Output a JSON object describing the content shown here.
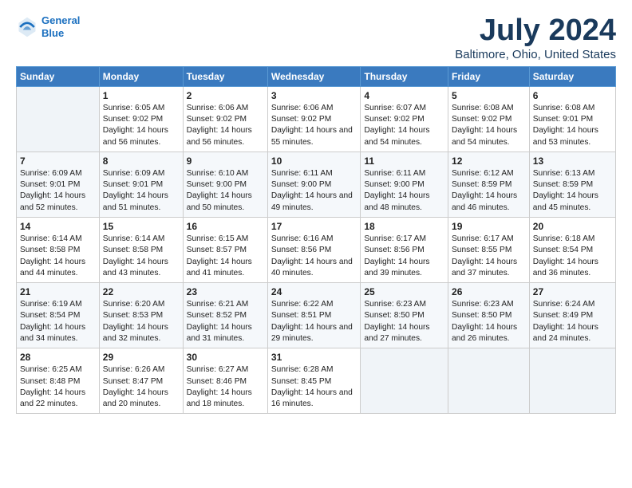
{
  "header": {
    "logo_line1": "General",
    "logo_line2": "Blue",
    "title": "July 2024",
    "subtitle": "Baltimore, Ohio, United States"
  },
  "columns": [
    "Sunday",
    "Monday",
    "Tuesday",
    "Wednesday",
    "Thursday",
    "Friday",
    "Saturday"
  ],
  "weeks": [
    [
      {
        "day": "",
        "sunrise": "",
        "sunset": "",
        "daylight": ""
      },
      {
        "day": "1",
        "sunrise": "Sunrise: 6:05 AM",
        "sunset": "Sunset: 9:02 PM",
        "daylight": "Daylight: 14 hours and 56 minutes."
      },
      {
        "day": "2",
        "sunrise": "Sunrise: 6:06 AM",
        "sunset": "Sunset: 9:02 PM",
        "daylight": "Daylight: 14 hours and 56 minutes."
      },
      {
        "day": "3",
        "sunrise": "Sunrise: 6:06 AM",
        "sunset": "Sunset: 9:02 PM",
        "daylight": "Daylight: 14 hours and 55 minutes."
      },
      {
        "day": "4",
        "sunrise": "Sunrise: 6:07 AM",
        "sunset": "Sunset: 9:02 PM",
        "daylight": "Daylight: 14 hours and 54 minutes."
      },
      {
        "day": "5",
        "sunrise": "Sunrise: 6:08 AM",
        "sunset": "Sunset: 9:02 PM",
        "daylight": "Daylight: 14 hours and 54 minutes."
      },
      {
        "day": "6",
        "sunrise": "Sunrise: 6:08 AM",
        "sunset": "Sunset: 9:01 PM",
        "daylight": "Daylight: 14 hours and 53 minutes."
      }
    ],
    [
      {
        "day": "7",
        "sunrise": "Sunrise: 6:09 AM",
        "sunset": "Sunset: 9:01 PM",
        "daylight": "Daylight: 14 hours and 52 minutes."
      },
      {
        "day": "8",
        "sunrise": "Sunrise: 6:09 AM",
        "sunset": "Sunset: 9:01 PM",
        "daylight": "Daylight: 14 hours and 51 minutes."
      },
      {
        "day": "9",
        "sunrise": "Sunrise: 6:10 AM",
        "sunset": "Sunset: 9:00 PM",
        "daylight": "Daylight: 14 hours and 50 minutes."
      },
      {
        "day": "10",
        "sunrise": "Sunrise: 6:11 AM",
        "sunset": "Sunset: 9:00 PM",
        "daylight": "Daylight: 14 hours and 49 minutes."
      },
      {
        "day": "11",
        "sunrise": "Sunrise: 6:11 AM",
        "sunset": "Sunset: 9:00 PM",
        "daylight": "Daylight: 14 hours and 48 minutes."
      },
      {
        "day": "12",
        "sunrise": "Sunrise: 6:12 AM",
        "sunset": "Sunset: 8:59 PM",
        "daylight": "Daylight: 14 hours and 46 minutes."
      },
      {
        "day": "13",
        "sunrise": "Sunrise: 6:13 AM",
        "sunset": "Sunset: 8:59 PM",
        "daylight": "Daylight: 14 hours and 45 minutes."
      }
    ],
    [
      {
        "day": "14",
        "sunrise": "Sunrise: 6:14 AM",
        "sunset": "Sunset: 8:58 PM",
        "daylight": "Daylight: 14 hours and 44 minutes."
      },
      {
        "day": "15",
        "sunrise": "Sunrise: 6:14 AM",
        "sunset": "Sunset: 8:58 PM",
        "daylight": "Daylight: 14 hours and 43 minutes."
      },
      {
        "day": "16",
        "sunrise": "Sunrise: 6:15 AM",
        "sunset": "Sunset: 8:57 PM",
        "daylight": "Daylight: 14 hours and 41 minutes."
      },
      {
        "day": "17",
        "sunrise": "Sunrise: 6:16 AM",
        "sunset": "Sunset: 8:56 PM",
        "daylight": "Daylight: 14 hours and 40 minutes."
      },
      {
        "day": "18",
        "sunrise": "Sunrise: 6:17 AM",
        "sunset": "Sunset: 8:56 PM",
        "daylight": "Daylight: 14 hours and 39 minutes."
      },
      {
        "day": "19",
        "sunrise": "Sunrise: 6:17 AM",
        "sunset": "Sunset: 8:55 PM",
        "daylight": "Daylight: 14 hours and 37 minutes."
      },
      {
        "day": "20",
        "sunrise": "Sunrise: 6:18 AM",
        "sunset": "Sunset: 8:54 PM",
        "daylight": "Daylight: 14 hours and 36 minutes."
      }
    ],
    [
      {
        "day": "21",
        "sunrise": "Sunrise: 6:19 AM",
        "sunset": "Sunset: 8:54 PM",
        "daylight": "Daylight: 14 hours and 34 minutes."
      },
      {
        "day": "22",
        "sunrise": "Sunrise: 6:20 AM",
        "sunset": "Sunset: 8:53 PM",
        "daylight": "Daylight: 14 hours and 32 minutes."
      },
      {
        "day": "23",
        "sunrise": "Sunrise: 6:21 AM",
        "sunset": "Sunset: 8:52 PM",
        "daylight": "Daylight: 14 hours and 31 minutes."
      },
      {
        "day": "24",
        "sunrise": "Sunrise: 6:22 AM",
        "sunset": "Sunset: 8:51 PM",
        "daylight": "Daylight: 14 hours and 29 minutes."
      },
      {
        "day": "25",
        "sunrise": "Sunrise: 6:23 AM",
        "sunset": "Sunset: 8:50 PM",
        "daylight": "Daylight: 14 hours and 27 minutes."
      },
      {
        "day": "26",
        "sunrise": "Sunrise: 6:23 AM",
        "sunset": "Sunset: 8:50 PM",
        "daylight": "Daylight: 14 hours and 26 minutes."
      },
      {
        "day": "27",
        "sunrise": "Sunrise: 6:24 AM",
        "sunset": "Sunset: 8:49 PM",
        "daylight": "Daylight: 14 hours and 24 minutes."
      }
    ],
    [
      {
        "day": "28",
        "sunrise": "Sunrise: 6:25 AM",
        "sunset": "Sunset: 8:48 PM",
        "daylight": "Daylight: 14 hours and 22 minutes."
      },
      {
        "day": "29",
        "sunrise": "Sunrise: 6:26 AM",
        "sunset": "Sunset: 8:47 PM",
        "daylight": "Daylight: 14 hours and 20 minutes."
      },
      {
        "day": "30",
        "sunrise": "Sunrise: 6:27 AM",
        "sunset": "Sunset: 8:46 PM",
        "daylight": "Daylight: 14 hours and 18 minutes."
      },
      {
        "day": "31",
        "sunrise": "Sunrise: 6:28 AM",
        "sunset": "Sunset: 8:45 PM",
        "daylight": "Daylight: 14 hours and 16 minutes."
      },
      {
        "day": "",
        "sunrise": "",
        "sunset": "",
        "daylight": ""
      },
      {
        "day": "",
        "sunrise": "",
        "sunset": "",
        "daylight": ""
      },
      {
        "day": "",
        "sunrise": "",
        "sunset": "",
        "daylight": ""
      }
    ]
  ]
}
